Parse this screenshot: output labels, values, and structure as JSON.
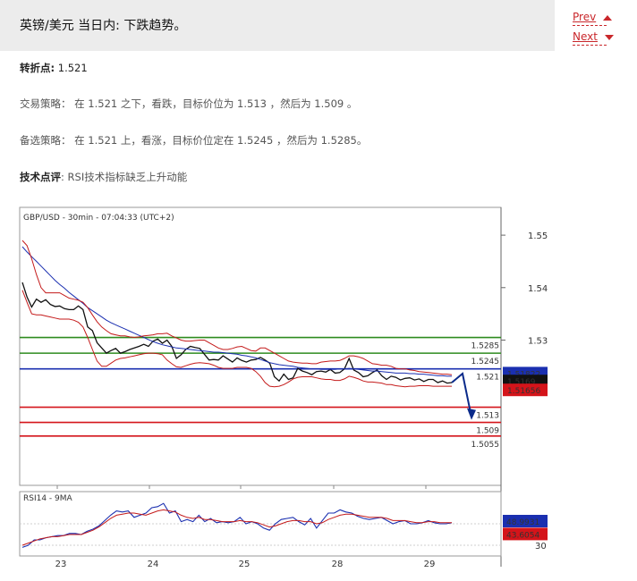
{
  "header": {
    "title": "英镑/美元 当日内: 下跌趋势。"
  },
  "nav": {
    "prev": "Prev",
    "next": "Next"
  },
  "content": {
    "pivot_label": "转折点:",
    "pivot_value": "1.521",
    "strategy_label": "交易策略：",
    "strategy_text": "在 1.521 之下，看跌，目标价位为 1.513 ，然后为 1.509 。",
    "alt_label": "备选策略：",
    "alt_text": "在 1.521 上，看涨，目标价位定在 1.5245 ，然后为 1.5285。",
    "comment_label": "技术点评",
    "comment_text": ": RSI技术指标缺乏上升动能"
  },
  "chart_data": {
    "type": "line",
    "title": "GBP/USD - 30min - 07:04:33 (UTC+2)",
    "y_ticks": [
      "1.55",
      "1.54",
      "1.53"
    ],
    "ylim": [
      1.5023,
      1.5553
    ],
    "x_ticks": [
      "23",
      "24",
      "25",
      "28",
      "29"
    ],
    "levels": [
      {
        "label": "1.5285",
        "value": 1.5305,
        "color": "#2e8b1e"
      },
      {
        "label": "1.5245",
        "value": 1.5275,
        "color": "#2e8b1e"
      },
      {
        "label": "1.521",
        "value": 1.5245,
        "color": "#1a2fb0"
      },
      {
        "label": "1.513",
        "value": 1.5172,
        "color": "#d4141a"
      },
      {
        "label": "1.509",
        "value": 1.5143,
        "color": "#d4141a"
      },
      {
        "label": "1.5055",
        "value": 1.5117,
        "color": "#d4141a"
      }
    ],
    "price_tags": [
      {
        "label": "1.51822",
        "value": 1.5237,
        "bg": "#1a2fb0"
      },
      {
        "label": "1.5169",
        "value": 1.5222,
        "bg": "#111111"
      },
      {
        "label": "1.51656",
        "value": 1.5205,
        "bg": "#d4141a"
      }
    ],
    "series": [
      {
        "name": "price",
        "color": "#111111",
        "values": [
          1.541,
          1.5382,
          1.5363,
          1.5378,
          1.5372,
          1.5377,
          1.5368,
          1.5364,
          1.5365,
          1.536,
          1.5358,
          1.5358,
          1.5365,
          1.5358,
          1.5325,
          1.5318,
          1.5295,
          1.5285,
          1.5275,
          1.528,
          1.5284,
          1.5275,
          1.5278,
          1.5282,
          1.5285,
          1.5288,
          1.5292,
          1.5288,
          1.5298,
          1.5302,
          1.5294,
          1.53,
          1.5288,
          1.5265,
          1.5272,
          1.5282,
          1.5288,
          1.5286,
          1.5284,
          1.5273,
          1.5262,
          1.5263,
          1.5262,
          1.527,
          1.5264,
          1.5258,
          1.5266,
          1.5261,
          1.5258,
          1.5262,
          1.5263,
          1.5267,
          1.5262,
          1.5256,
          1.523,
          1.5222,
          1.5235,
          1.5225,
          1.5228,
          1.5246,
          1.5241,
          1.5238,
          1.5234,
          1.524,
          1.5241,
          1.5239,
          1.5244,
          1.5237,
          1.5238,
          1.5245,
          1.5265,
          1.5243,
          1.5238,
          1.523,
          1.5232,
          1.5238,
          1.5243,
          1.5232,
          1.5225,
          1.5231,
          1.5229,
          1.5224,
          1.5227,
          1.5228,
          1.5224,
          1.5226,
          1.5221,
          1.5225,
          1.5225,
          1.5219,
          1.5222,
          1.5218,
          1.5219
        ]
      },
      {
        "name": "ma",
        "color": "#1a2fb0",
        "values": [
          1.5478,
          1.5468,
          1.5459,
          1.545,
          1.5441,
          1.5432,
          1.5423,
          1.5414,
          1.5406,
          1.5399,
          1.5391,
          1.5384,
          1.5377,
          1.537,
          1.5362,
          1.5356,
          1.535,
          1.5344,
          1.5338,
          1.5333,
          1.5329,
          1.5325,
          1.5321,
          1.5317,
          1.5313,
          1.5309,
          1.5305,
          1.5301,
          1.5297,
          1.5294,
          1.5291,
          1.5289,
          1.5287,
          1.5285,
          1.5284,
          1.5283,
          1.5282,
          1.5281,
          1.528,
          1.5279,
          1.5278,
          1.5277,
          1.5277,
          1.5276,
          1.5275,
          1.5274,
          1.5273,
          1.5271,
          1.527,
          1.5268,
          1.5266,
          1.5263,
          1.526,
          1.5257,
          1.5255,
          1.5253,
          1.5252,
          1.5251,
          1.525,
          1.5248,
          1.5247,
          1.5246,
          1.5245,
          1.5245,
          1.5244,
          1.5244,
          1.5244,
          1.5244,
          1.5245,
          1.5245,
          1.5246,
          1.5245,
          1.5244,
          1.5243,
          1.5242,
          1.5241,
          1.5241,
          1.524,
          1.5239,
          1.5238,
          1.5237,
          1.5237,
          1.5237,
          1.5236,
          1.5236,
          1.5235,
          1.5235,
          1.5234,
          1.5233,
          1.5232,
          1.5232,
          1.5231,
          1.5231
        ]
      },
      {
        "name": "upper-band",
        "color": "#c41a1a",
        "values": [
          1.549,
          1.548,
          1.5455,
          1.5425,
          1.54,
          1.539,
          1.539,
          1.539,
          1.539,
          1.5385,
          1.538,
          1.5378,
          1.5376,
          1.5372,
          1.5362,
          1.5348,
          1.5335,
          1.5325,
          1.5318,
          1.5312,
          1.531,
          1.5308,
          1.5308,
          1.5306,
          1.5305,
          1.5306,
          1.5308,
          1.5309,
          1.531,
          1.5312,
          1.5312,
          1.5313,
          1.5308,
          1.5304,
          1.53,
          1.5298,
          1.5298,
          1.5299,
          1.53,
          1.53,
          1.5295,
          1.529,
          1.5285,
          1.5282,
          1.5282,
          1.5284,
          1.5287,
          1.5288,
          1.5284,
          1.528,
          1.5279,
          1.5285,
          1.5285,
          1.528,
          1.5275,
          1.527,
          1.5265,
          1.526,
          1.5258,
          1.5257,
          1.5256,
          1.5256,
          1.5255,
          1.5255,
          1.5258,
          1.5259,
          1.526,
          1.526,
          1.5261,
          1.5265,
          1.527,
          1.527,
          1.5268,
          1.5265,
          1.526,
          1.5255,
          1.5254,
          1.5252,
          1.5252,
          1.525,
          1.5246,
          1.5245,
          1.5245,
          1.5243,
          1.5242,
          1.524,
          1.5239,
          1.5238,
          1.5237,
          1.5236,
          1.5235,
          1.5235,
          1.5234
        ]
      },
      {
        "name": "lower-band",
        "color": "#c41a1a",
        "values": [
          1.5395,
          1.5372,
          1.535,
          1.5348,
          1.5348,
          1.5346,
          1.5344,
          1.5342,
          1.534,
          1.534,
          1.534,
          1.5338,
          1.5334,
          1.5325,
          1.5305,
          1.5282,
          1.526,
          1.525,
          1.525,
          1.5256,
          1.5262,
          1.5265,
          1.5266,
          1.5268,
          1.527,
          1.5272,
          1.5274,
          1.5275,
          1.5275,
          1.5274,
          1.5272,
          1.5262,
          1.5255,
          1.5249,
          1.5248,
          1.5251,
          1.5254,
          1.5256,
          1.5257,
          1.5256,
          1.5255,
          1.5252,
          1.5248,
          1.5246,
          1.5246,
          1.5246,
          1.5248,
          1.5248,
          1.5248,
          1.5246,
          1.524,
          1.5231,
          1.5219,
          1.5212,
          1.5211,
          1.5212,
          1.5215,
          1.522,
          1.5226,
          1.5229,
          1.523,
          1.523,
          1.523,
          1.5228,
          1.5226,
          1.5225,
          1.5225,
          1.5223,
          1.5223,
          1.5226,
          1.5231,
          1.5229,
          1.5226,
          1.5222,
          1.522,
          1.522,
          1.5219,
          1.5218,
          1.5215,
          1.5215,
          1.5213,
          1.5212,
          1.5211,
          1.5212,
          1.5212,
          1.5213,
          1.5213,
          1.5213,
          1.5212,
          1.5212,
          1.5212,
          1.5212,
          1.5212
        ]
      }
    ],
    "forecast": [
      [
        1.5219,
        1.5219
      ],
      [
        1.5236,
        1.5236
      ],
      [
        1.5153,
        1.5153
      ]
    ],
    "rsi": {
      "title": "RSI14 - 9MA",
      "ylim": [
        20,
        80
      ],
      "ticks": [
        "50",
        "30"
      ],
      "tags": [
        {
          "label": "48.9931",
          "value": 52.5,
          "bg": "#1a2fb0"
        },
        {
          "label": "43.6054",
          "value": 40.5,
          "bg": "#d4141a"
        }
      ],
      "rsi_values": [
        28,
        30,
        35,
        35,
        37,
        38,
        39,
        39,
        41,
        41,
        40,
        43,
        45,
        48,
        53,
        58,
        62,
        61,
        62,
        56,
        58,
        60,
        65,
        66,
        69,
        60,
        62,
        52,
        54,
        52,
        58,
        52,
        55,
        51,
        52,
        51,
        52,
        56,
        50,
        52,
        50,
        46,
        44,
        50,
        54,
        55,
        56,
        52,
        49,
        55,
        46,
        53,
        60,
        60,
        63,
        61,
        60,
        57,
        55,
        54,
        55,
        56,
        53,
        50,
        52,
        53,
        50,
        50,
        51,
        53,
        51,
        50,
        50,
        51
      ],
      "ma_values": [
        30,
        32,
        34,
        36,
        37,
        38,
        38,
        39,
        40,
        40,
        40,
        42,
        44,
        47,
        51,
        55,
        58,
        59,
        60,
        60,
        59,
        58,
        60,
        62,
        63,
        62,
        61,
        58,
        56,
        55,
        56,
        54,
        54,
        53,
        52,
        52,
        52,
        53,
        52,
        52,
        51,
        49,
        47,
        48,
        50,
        52,
        53,
        53,
        52,
        52,
        50,
        51,
        54,
        56,
        58,
        59,
        59,
        58,
        57,
        56,
        56,
        56,
        55,
        53,
        53,
        53,
        52,
        51,
        51,
        52,
        52,
        51,
        51,
        51
      ]
    }
  }
}
